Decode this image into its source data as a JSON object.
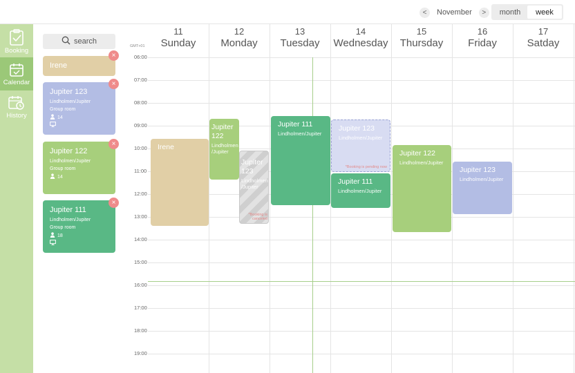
{
  "topbar": {
    "month": "November",
    "prev": "<",
    "next": ">",
    "view_month": "month",
    "view_week": "week"
  },
  "nav": [
    {
      "label": "Booking",
      "icon": "clipboard-check-icon",
      "active": false
    },
    {
      "label": "Calendar",
      "icon": "calendar-icon",
      "active": true
    },
    {
      "label": "History",
      "icon": "calendar-clock-icon",
      "active": false
    }
  ],
  "panel": {
    "search_label": "search",
    "cards": [
      {
        "name": "Irene",
        "color": "#e1cfa6"
      },
      {
        "name": "Jupiter 123",
        "location": "Lindholmen/Jupiter",
        "type": "Group room",
        "capacity": "14",
        "color": "#b3bde4"
      },
      {
        "name": "Jupiter 122",
        "location": "Lindholmen/Jupiter",
        "type": "Group room",
        "capacity": "14",
        "color": "#a7cf7c"
      },
      {
        "name": "Jupiter 111",
        "location": "Lindholmen/Jupiter",
        "type": "Group room",
        "capacity": "18",
        "color": "#59b885"
      }
    ],
    "remove_glyph": "×"
  },
  "calendar": {
    "timezone": "GMT+01",
    "days": [
      {
        "num": "11",
        "name": "Sunday"
      },
      {
        "num": "12",
        "name": "Monday"
      },
      {
        "num": "13",
        "name": "Tuesday"
      },
      {
        "num": "14",
        "name": "Wednesday"
      },
      {
        "num": "15",
        "name": "Thursday"
      },
      {
        "num": "16",
        "name": "Friday"
      },
      {
        "num": "17",
        "name": "Satday"
      }
    ],
    "hours": [
      "06:00",
      "07:00",
      "08:00",
      "09:00",
      "10:00",
      "11:00",
      "12:00",
      "13:00",
      "14:00",
      "15:00",
      "16:00",
      "17:00",
      "18:00",
      "19:00"
    ],
    "events": [
      {
        "title": "Irene",
        "location": "",
        "color": "#e1cfa6"
      },
      {
        "title": "Jupiter 122",
        "location": "Lindholmen /Jupiter",
        "color": "#a7cf7c"
      },
      {
        "title": "Jupiter 123",
        "location": "Lindholmen /Jupiter",
        "note": "*Booking is canceled",
        "state": "cancelled"
      },
      {
        "title": "Jupiter 111",
        "location": "Lindholmen/Jupiter",
        "color": "#59b885"
      },
      {
        "title": "Jupiter 123",
        "location": "Lindholmen/Jupiter",
        "note": "*Booking is pending now",
        "state": "pending"
      },
      {
        "title": "Jupiter 111",
        "location": "Lindholmen/Jupiter",
        "color": "#59b885"
      },
      {
        "title": "Jupiter 122",
        "location": "Lindholmen/Jupiter",
        "color": "#a7cf7c"
      },
      {
        "title": "Jupiter 123",
        "location": "Lindholmen/Jupiter",
        "color": "#b3bde4"
      }
    ]
  }
}
